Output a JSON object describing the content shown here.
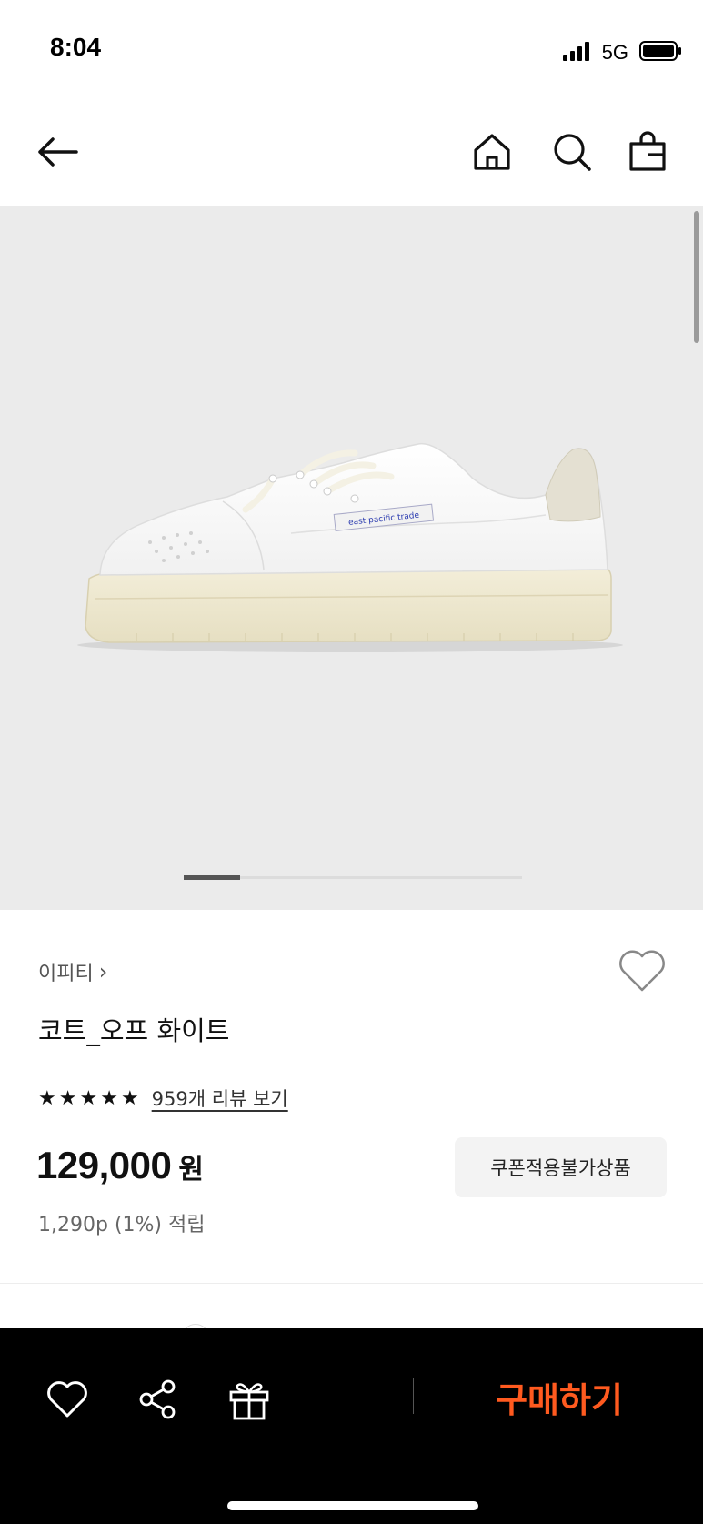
{
  "status_bar": {
    "time": "8:04",
    "network": "5G"
  },
  "nav": {
    "icons": [
      "back-arrow-icon",
      "home-icon",
      "search-icon",
      "shopping-bag-icon"
    ]
  },
  "gallery": {
    "image": "white leather low-top sneaker with cream sole",
    "label_text": "east pacific trade"
  },
  "product": {
    "brand": "이피티",
    "brand_chevron": "›",
    "name": "코트_오프 화이트",
    "review_link": "959개 리뷰 보기",
    "price": "129,000",
    "price_unit": "원",
    "coupon_badge": "쿠폰적용불가상품",
    "points": "1,290p (1%) 적립"
  },
  "bottom_bar": {
    "buy_label": "구매하기",
    "icons": [
      "heart-icon",
      "share-icon",
      "gift-icon"
    ]
  },
  "colors": {
    "accent": "#ff5a1f",
    "gallery_bg": "#ebebeb",
    "bottom_bg": "#000000"
  }
}
